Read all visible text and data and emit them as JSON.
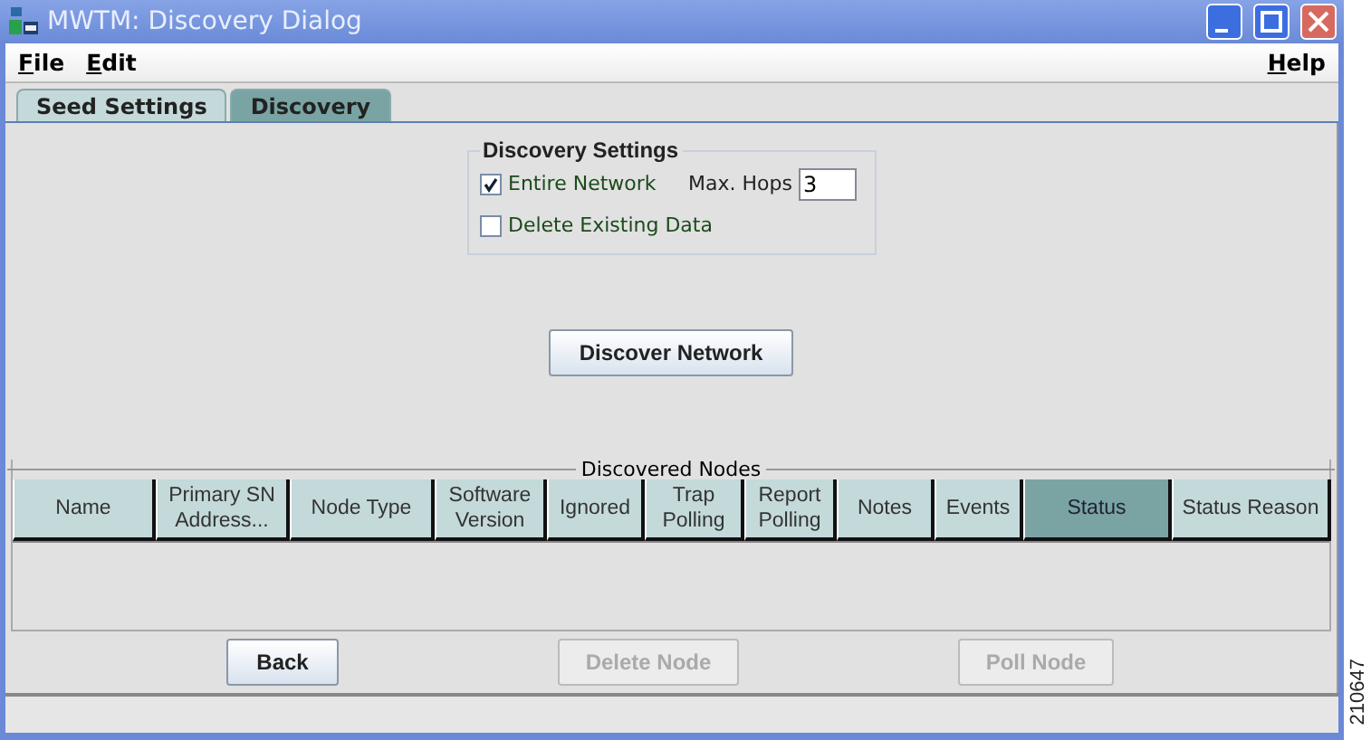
{
  "window": {
    "title": "MWTM: Discovery Dialog"
  },
  "menu": {
    "left": [
      "File",
      "Edit"
    ],
    "right": [
      "Help"
    ]
  },
  "tabs": [
    {
      "label": "Seed Settings",
      "selected": false
    },
    {
      "label": "Discovery",
      "selected": true
    }
  ],
  "discovery_settings": {
    "title": "Discovery Settings",
    "options": [
      {
        "label": "Entire Network",
        "checked": true
      },
      {
        "label": "Delete Existing Data",
        "checked": false
      }
    ],
    "max_hops": {
      "label": "Max. Hops",
      "value": "3"
    }
  },
  "discover_button": "Discover Network",
  "table": {
    "title": "Discovered Nodes",
    "columns": [
      {
        "label": "Name",
        "selected": false
      },
      {
        "label": "Primary SN Address...",
        "selected": false
      },
      {
        "label": "Node Type",
        "selected": false
      },
      {
        "label": "Software Version",
        "selected": false
      },
      {
        "label": "Ignored",
        "selected": false
      },
      {
        "label": "Trap Polling",
        "selected": false
      },
      {
        "label": "Report Polling",
        "selected": false
      },
      {
        "label": "Notes",
        "selected": false
      },
      {
        "label": "Events",
        "selected": false
      },
      {
        "label": "Status",
        "selected": true
      },
      {
        "label": "Status Reason",
        "selected": false
      }
    ]
  },
  "buttons": [
    {
      "label": "Back",
      "disabled": false
    },
    {
      "label": "Delete Node",
      "disabled": true
    },
    {
      "label": "Poll Node",
      "disabled": true
    }
  ],
  "figure_number": "210647"
}
